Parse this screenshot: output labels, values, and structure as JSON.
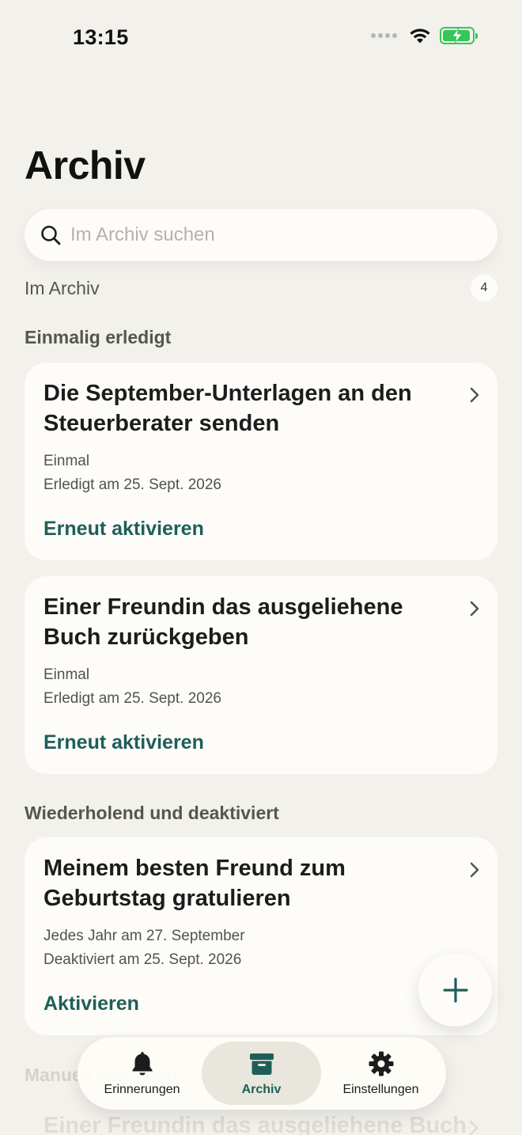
{
  "status_bar": {
    "time": "13:15",
    "icons": [
      "signal-dots-icon",
      "wifi-icon",
      "battery-charging-icon"
    ],
    "battery_level": 0.85,
    "battery_color": "#34c759"
  },
  "page": {
    "title": "Archiv"
  },
  "search": {
    "placeholder": "Im Archiv suchen",
    "value": ""
  },
  "archive_summary": {
    "label": "Im Archiv",
    "count": "4"
  },
  "sections": [
    {
      "title": "Einmalig erledigt",
      "cards": [
        {
          "title": "Die September-Unterlagen an den Steuerberater senden",
          "frequency": "Einmal",
          "status": "Erledigt am 25. Sept. 2026",
          "action": "Erneut aktivieren"
        },
        {
          "title": "Einer Freundin das ausgeliehene Buch zurückgeben",
          "frequency": "Einmal",
          "status": "Erledigt am 25. Sept. 2026",
          "action": "Erneut aktivieren"
        }
      ]
    },
    {
      "title": "Wiederholend und deaktiviert",
      "cards": [
        {
          "title": "Meinem besten Freund zum Geburtstag gratulieren",
          "frequency": "Jedes Jahr am 27. September",
          "status": "Deaktiviert am 25. Sept. 2026",
          "action": "Aktivieren"
        }
      ]
    },
    {
      "title": "Manuell archiviert",
      "cards": [
        {
          "title": "Einer Freundin das ausgeliehene Buch"
        }
      ]
    }
  ],
  "tabs": [
    {
      "label": "Erinnerungen",
      "icon": "bell-icon",
      "active": false
    },
    {
      "label": "Archiv",
      "icon": "archive-box-icon",
      "active": true
    },
    {
      "label": "Einstellungen",
      "icon": "gear-icon",
      "active": false
    }
  ],
  "fab": {
    "icon": "plus-icon"
  },
  "colors": {
    "background": "#f3f1ec",
    "card": "#fdfcf8",
    "accent": "#1e5e5a",
    "active_tab": "#e9e6dd",
    "muted_text": "#55564f"
  }
}
